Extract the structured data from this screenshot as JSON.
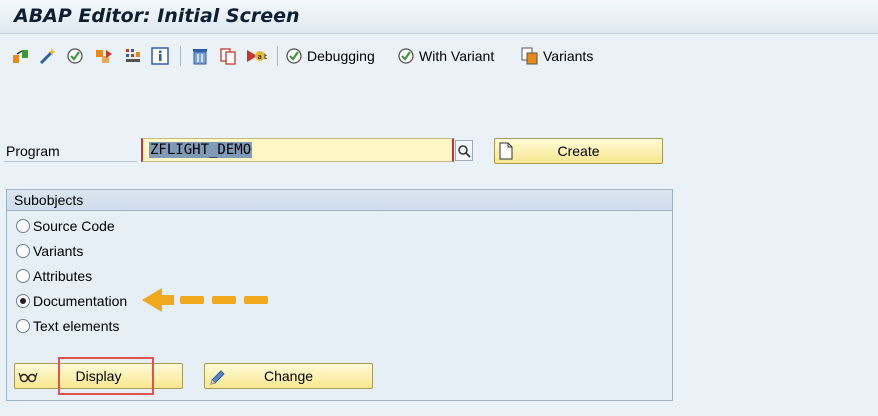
{
  "window": {
    "title": "ABAP Editor: Initial Screen"
  },
  "toolbar": {
    "icons": [
      "where-used-icon",
      "magic-wand-icon",
      "check-icon",
      "other-object-icon",
      "object-list-icon",
      "info-icon",
      "delete-icon",
      "copy-icon",
      "rename-icon"
    ],
    "debugging_label": "Debugging",
    "with_variant_label": "With Variant",
    "variants_label": "Variants"
  },
  "program": {
    "label": "Program",
    "value": "ZFLIGHT_DEMO",
    "create_label": "Create"
  },
  "subobjects": {
    "title": "Subobjects",
    "options": [
      {
        "label": "Source Code",
        "selected": false
      },
      {
        "label": "Variants",
        "selected": false
      },
      {
        "label": "Attributes",
        "selected": false
      },
      {
        "label": "Documentation",
        "selected": true
      },
      {
        "label": "Text elements",
        "selected": false
      }
    ]
  },
  "actions": {
    "display_label": "Display",
    "change_label": "Change"
  },
  "colors": {
    "accent_highlight": "#e0534f",
    "arrow": "#f0a81c",
    "button_yellow": "#f8e78f",
    "background": "#eaf1f7"
  }
}
